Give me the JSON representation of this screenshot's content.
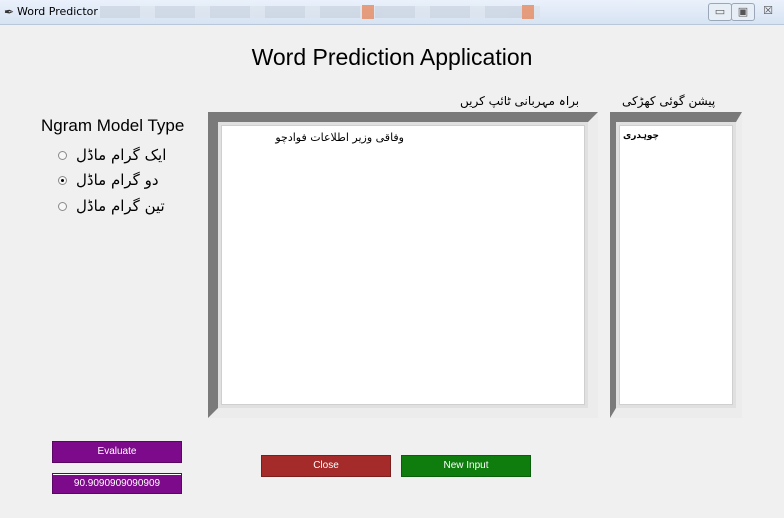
{
  "window": {
    "title": "Word Predictor",
    "controls": {
      "minimize": "▭",
      "maximize": "▣",
      "close": "☒"
    }
  },
  "heading": "Word Prediction Application",
  "ngram": {
    "title": "Ngram Model Type",
    "options": [
      {
        "label": "ایک گرام ماڈل",
        "selected": false
      },
      {
        "label": "دو گرام ماڈل",
        "selected": true
      },
      {
        "label": "تین گرام ماڈل",
        "selected": false
      }
    ]
  },
  "input": {
    "label": "براہ مہربانی ٹائپ کریں",
    "text": "وفاقی وزیر اطلاعات فوادچو"
  },
  "prediction": {
    "label": "پیشن گوئی کھڑکی",
    "items": [
      "چوہدری"
    ]
  },
  "buttons": {
    "evaluate": "Evaluate",
    "score": "90.9090909090909",
    "close": "Close",
    "new_input": "New Input"
  },
  "colors": {
    "evaluate": "#7d0a8a",
    "close": "#a52a2a",
    "new_input": "#0e7d0e"
  }
}
